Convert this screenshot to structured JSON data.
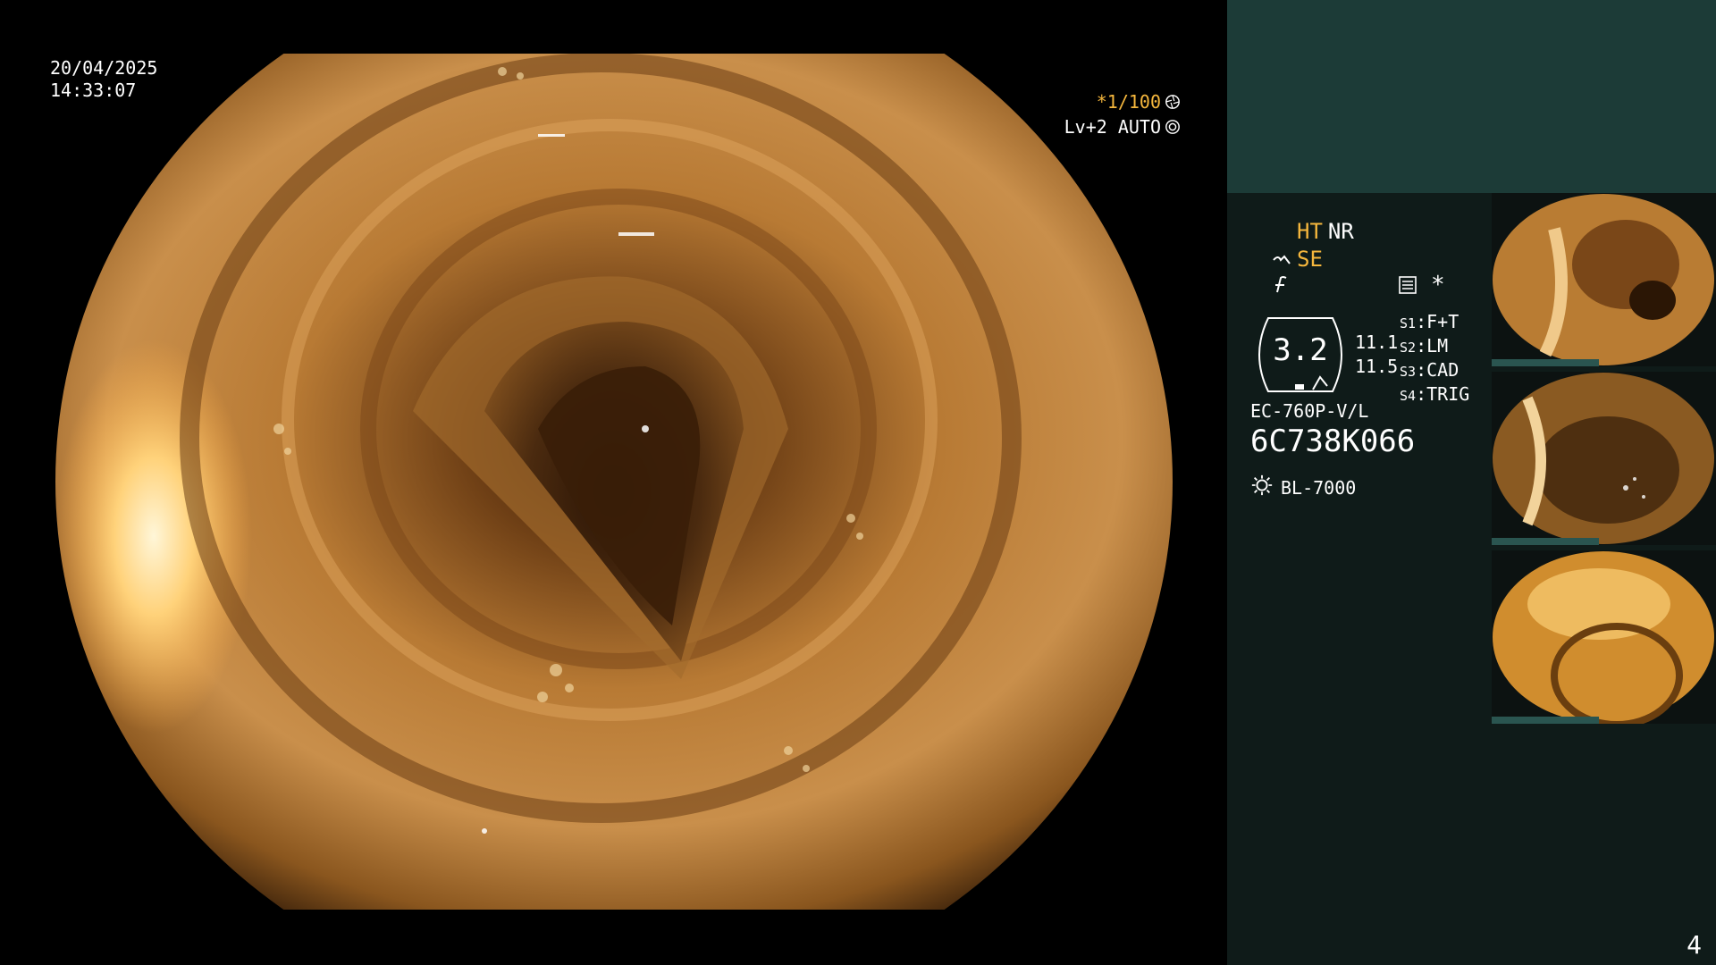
{
  "overlay": {
    "date": "20/04/2025",
    "time": "14:33:07",
    "shutter": "*1/100",
    "shutter_icon": "shutter-icon",
    "level": "Lv+2",
    "mode": "AUTO",
    "mode_icon": "iris-icon"
  },
  "status": {
    "ht": "HT",
    "nr": "NR",
    "se": "SE",
    "ht_color": "#f5b73d",
    "se_color": "#f5b73d"
  },
  "zoom": {
    "value": "3.2",
    "sub1": "11.1",
    "sub2": "11.5"
  },
  "scene_buttons": [
    {
      "key": "S1",
      "value": "F+T"
    },
    {
      "key": "S2",
      "value": "LM"
    },
    {
      "key": "S3",
      "value": "CAD"
    },
    {
      "key": "S4",
      "value": "TRIG"
    }
  ],
  "scope": {
    "model": "EC-760P-V/L",
    "serial": "6C738K066",
    "light_source": "BL-7000"
  },
  "panel_colors": {
    "top": "#1c3b37",
    "body": "#0f1b19"
  },
  "page_number": "4"
}
